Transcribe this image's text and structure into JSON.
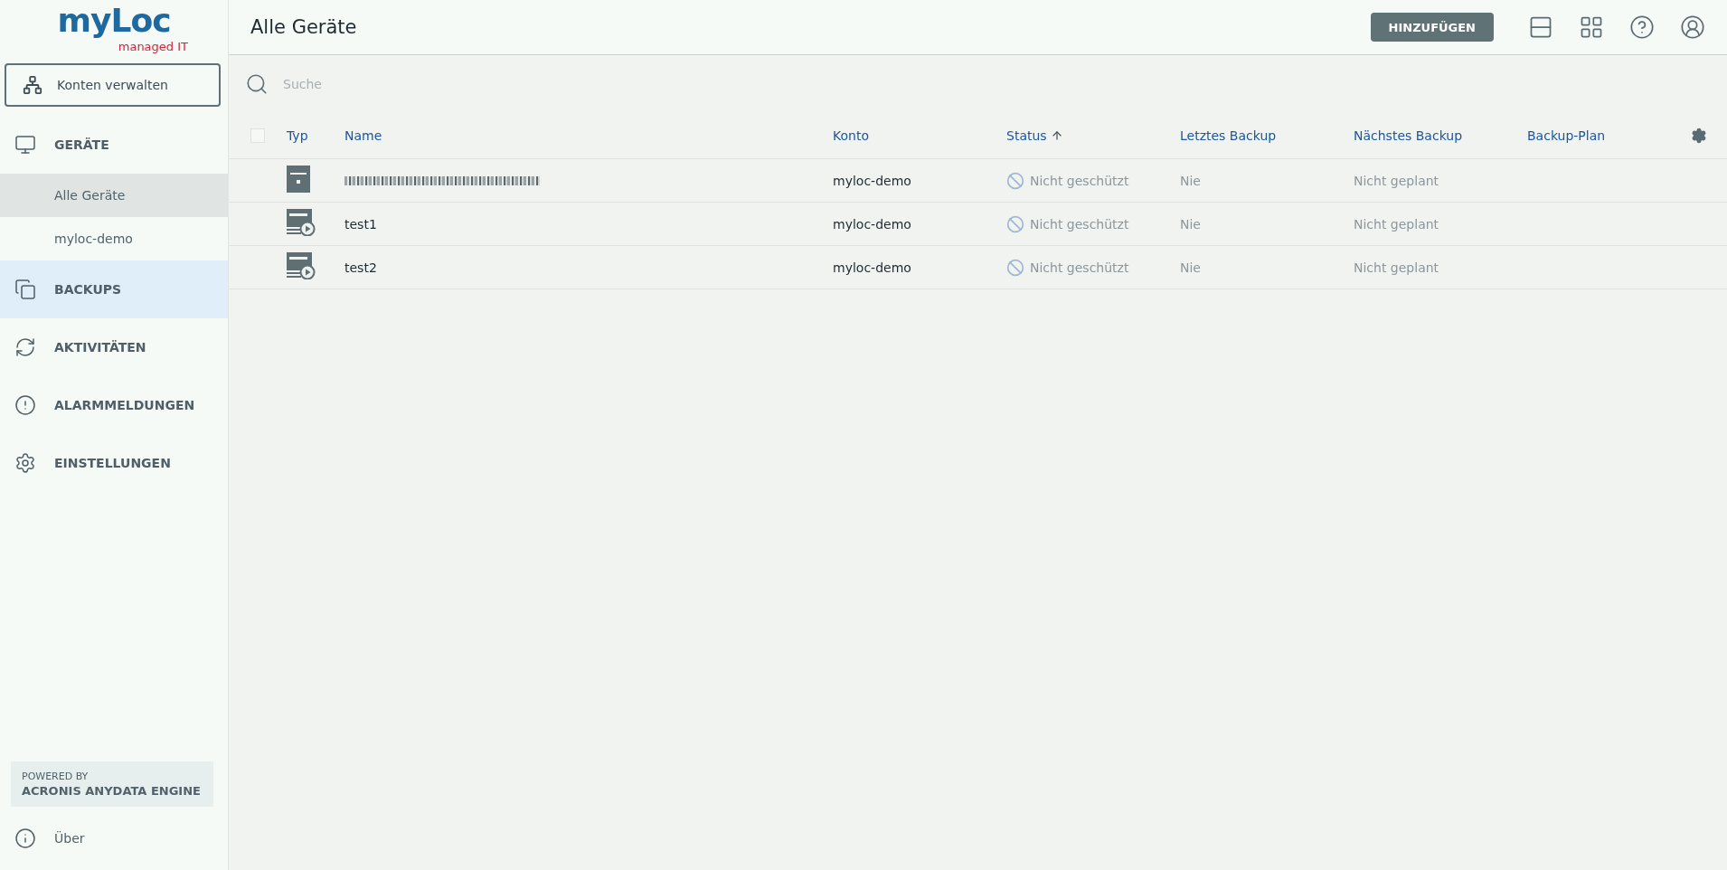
{
  "logo": {
    "wordmark": "myLoc",
    "tagline": "managed IT"
  },
  "sidebar": {
    "manage_button": "Konten verwalten",
    "nav": [
      {
        "kind": "section",
        "label": "GERÄTE",
        "selected": false,
        "hovered": false
      },
      {
        "kind": "subitem",
        "label": "Alle Geräte",
        "selected": true,
        "hovered": false
      },
      {
        "kind": "subitem",
        "label": "myloc-demo",
        "selected": false,
        "hovered": false
      },
      {
        "kind": "section",
        "label": "BACKUPS",
        "selected": false,
        "hovered": true
      },
      {
        "kind": "section",
        "label": "AKTIVITÄTEN",
        "selected": false,
        "hovered": false
      },
      {
        "kind": "section",
        "label": "ALARMMELDUNGEN",
        "selected": false,
        "hovered": false
      },
      {
        "kind": "section",
        "label": "EINSTELLUNGEN",
        "selected": false,
        "hovered": false
      }
    ],
    "powered_by": {
      "line_1": "POWERED BY",
      "line_2": "ACRONIS ANYDATA ENGINE"
    },
    "about": "Über"
  },
  "header": {
    "title": "Alle Geräte",
    "add_button": "HINZUFÜGEN"
  },
  "search": {
    "placeholder": "Suche"
  },
  "table": {
    "select_all_checked": false,
    "columns": [
      {
        "label": "Typ",
        "sorted_ascending": false
      },
      {
        "label": "Name",
        "sorted_ascending": false
      },
      {
        "label": "Konto",
        "sorted_ascending": false
      },
      {
        "label": "Status",
        "sorted_ascending": true
      },
      {
        "label": "Letztes Backup",
        "sorted_ascending": false
      },
      {
        "label": "Nächstes Backup",
        "sorted_ascending": false
      },
      {
        "label": "Backup-Plan",
        "sorted_ascending": false
      }
    ],
    "rows": [
      {
        "kind": "server",
        "redacted": true,
        "account": "myloc-demo",
        "status": "Nicht geschützt",
        "last_backup": "Nie",
        "next_backup": "Nicht geplant"
      },
      {
        "kind": "hyperv",
        "redacted": false,
        "name": "test1",
        "account": "myloc-demo",
        "status": "Nicht geschützt",
        "last_backup": "Nie",
        "next_backup": "Nicht geplant"
      },
      {
        "kind": "hyperv",
        "redacted": false,
        "name": "test2",
        "account": "myloc-demo",
        "status": "Nicht geschützt",
        "last_backup": "Nie",
        "next_backup": "Nicht geplant"
      }
    ]
  }
}
